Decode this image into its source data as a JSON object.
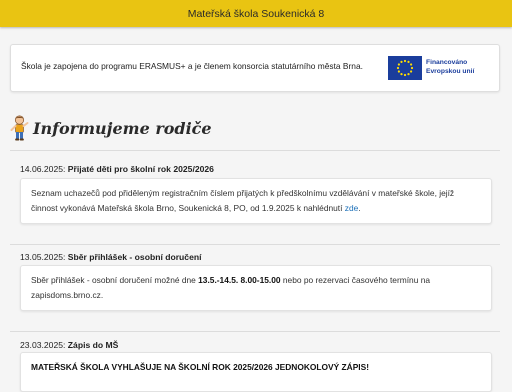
{
  "header": {
    "title": "Mateřská škola Soukenická 8"
  },
  "erasmus": {
    "text": "Škola je zapojena do programu ERASMUS+ a je členem konsorcia statutárního města Brna.",
    "eu_caption_line1": "Financováno",
    "eu_caption_line2": "Evropskou unií",
    "eu_flag_color": "#1a3d9c",
    "eu_star_color": "#ffdd00"
  },
  "section": {
    "title": "Informujeme rodiče",
    "icon": "child-figure-icon"
  },
  "news": [
    {
      "date": "14.06.2025:",
      "title": "Přijaté děti pro školní rok 2025/2026",
      "body_before_link": "Seznam uchazečů pod přiděleným registračním číslem přijatých k předškolnímu vzdělávání v mateřské škole, jejíž činnost vykonává Mateřská škola Brno, Soukenická 8, PO, od 1.9.2025 k nahlédnutí ",
      "link": "zde",
      "body_after_link": "."
    },
    {
      "date": "13.05.2025:",
      "title": "Sběr přihlášek - osobní doručení",
      "body_before_bold": "Sběr přihlášek - osobní doručení možné dne ",
      "bold": "13.5.-14.5. 8.00-15.00",
      "body_after_bold": " nebo po rezervaci časového termínu na zapisdoms.brno.cz."
    },
    {
      "date": "23.03.2025:",
      "title": "Zápis do MŠ",
      "headline": "MATEŘSKÁ ŠKOLA VYHLAŠUJE NA ŠKOLNÍ ROK 2025/2026 JEDNOKOLOVÝ ZÁPIS!"
    }
  ],
  "colors": {
    "accent": "#e9c412",
    "link": "#1b6fb8",
    "background": "#f5f5f5"
  }
}
